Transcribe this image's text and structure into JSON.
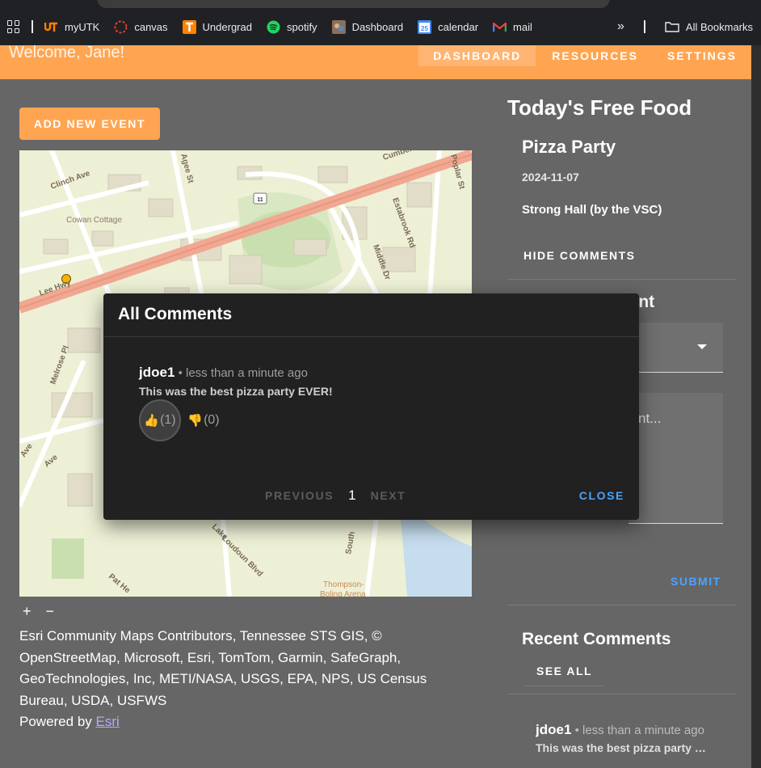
{
  "browser": {
    "bookmarks": [
      {
        "label": "myUTK",
        "icon": "utk-logo-icon",
        "color": "#ff8200"
      },
      {
        "label": "canvas",
        "icon": "canvas-logo-icon",
        "color": "#e2412e"
      },
      {
        "label": "Undergrad",
        "icon": "t-logo-icon",
        "color": "#ff8200"
      },
      {
        "label": "spotify",
        "icon": "spotify-icon",
        "color": "#1ed760"
      },
      {
        "label": "Dashboard",
        "icon": "dashboard-icon",
        "color": "#8a6f5a"
      },
      {
        "label": "calendar",
        "icon": "calendar-icon",
        "color": "#4285f4"
      },
      {
        "label": "mail",
        "icon": "gmail-icon",
        "color": "#ea4335"
      }
    ],
    "calendar_day": "25",
    "overflow": "»",
    "all_bookmarks": "All Bookmarks"
  },
  "header": {
    "welcome": "Welcome, Jane!",
    "nav": [
      "DASHBOARD",
      "RESOURCES",
      "SETTINGS"
    ],
    "active_nav": "DASHBOARD",
    "color": "#ffa552"
  },
  "main": {
    "add_event": "ADD NEW EVENT",
    "map": {
      "labels": [
        "Cumberland",
        "Clinch Ave",
        "Cowan Cottage",
        "Lee Hwy",
        "Agee St",
        "11",
        "Estabrook Rd",
        "Poplar St",
        "Middle Dr",
        "Melrose Pl",
        "Ave",
        "Ave",
        "Loudoun Blvd",
        "Pat He",
        "South",
        "Thompson-",
        "Boling Arena",
        "Lake"
      ]
    },
    "zoom_in": "+",
    "zoom_out": "−",
    "attribution": "Esri Community Maps Contributors, Tennessee STS GIS, © OpenStreetMap, Microsoft, Esri, TomTom, Garmin, SafeGraph, GeoTechnologies, Inc, METI/NASA, USGS, EPA, NPS, US Census Bureau, USDA, USFWS",
    "powered_by": "Powered by ",
    "esri_link": "Esri"
  },
  "sidebar": {
    "title": "Today's Free Food",
    "event": {
      "name": "Pizza Party",
      "date": "2024-11-07",
      "location": "Strong Hall (by the VSC)"
    },
    "hide_comments": "HIDE COMMENTS",
    "add_comment_partial": "ment",
    "comment_placeholder_partial": "nt...",
    "submit": "SUBMIT",
    "recent_title": "Recent Comments",
    "see_all": "SEE ALL",
    "recent": {
      "user": "jdoe1",
      "meta": " • less than a minute ago",
      "text": "This was the best pizza party EVER!"
    }
  },
  "modal": {
    "title": "All Comments",
    "comment": {
      "user": "jdoe1",
      "meta": " • less than a minute ago",
      "text": "This was the best pizza party EVER!",
      "up_count": "(1)",
      "down_count": "(0)"
    },
    "previous": "PREVIOUS",
    "page": "1",
    "next": "NEXT",
    "close": "CLOSE"
  }
}
